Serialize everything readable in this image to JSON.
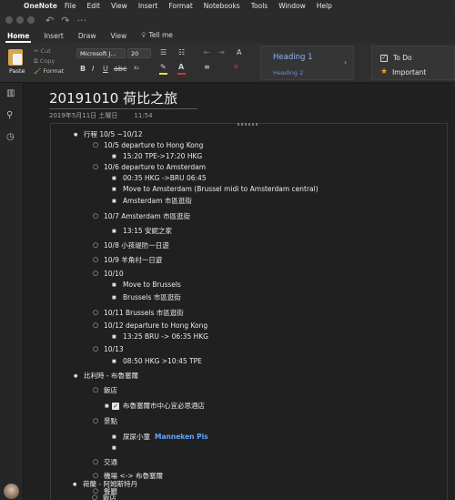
{
  "menubar": {
    "app": "OneNote",
    "items": [
      "File",
      "Edit",
      "View",
      "Insert",
      "Format",
      "Notebooks",
      "Tools",
      "Window",
      "Help"
    ]
  },
  "ribbon_tabs": [
    "Home",
    "Insert",
    "Draw",
    "View",
    "Tell me"
  ],
  "clipboard": {
    "paste": "Paste",
    "cut": "Cut",
    "copy": "Copy",
    "format": "Format"
  },
  "font": {
    "name": "Microsoft J...",
    "size": "20"
  },
  "styles": {
    "heading1": "Heading 1",
    "heading2": "Heading 2"
  },
  "tags": {
    "todo": "To Do",
    "important": "Important"
  },
  "colors": {
    "accent_link": "#5fa6ff",
    "heading_style": "#8fb3ee",
    "important_star": "#f0a020",
    "font_color_bar": "#e03030",
    "highlight_bar": "#f2e230"
  },
  "page": {
    "title": "20191010 荷比之旅",
    "date": "2019年5月11日 土曜日",
    "time": "11:54"
  },
  "outline": {
    "l01": "行程 10/5 ~10/12",
    "l02": "10/5 departure to Hong Kong",
    "l03": "15:20 TPE->17:20 HKG",
    "l04": "10/6 departure to Amsterdam",
    "l05": "00:35 HKG ->BRU 06:45",
    "l06": "Move to Amsterdam (Brussel midi to Amsterdam central)",
    "l07": "Amsterdam 市區逛街",
    "l08": "10/7 Amsterdam  市區逛街",
    "l09": "13:15 安妮之家",
    "l10": "10/8 小孩堤防一日遊",
    "l11": "10/9  羊角村一日遊",
    "l12": "10/10",
    "l13": "Move to Brussels",
    "l14": "Brussels 市區逛街",
    "l15": "10/11 Brussels 市區逛街",
    "l16": "10/12 departure to Hong Kong",
    "l17": "13:25 BRU -> 06:35 HKG",
    "l18": "10/13",
    "l19": "08:50 HKG >10:45 TPE",
    "l20": "比利時 - 布魯塞爾",
    "l21": "飯店",
    "l22": "布魯塞爾市中心宜必思酒店",
    "l23": "景點",
    "l24": "尿尿小童",
    "l24_link": "Manneken Pis",
    "l25": "交通",
    "l26": "機場 <-> 布魯塞爾",
    "l27": "餐廳",
    "l28": "荷蘭 - 阿姆斯特丹",
    "l29": "飯店"
  }
}
